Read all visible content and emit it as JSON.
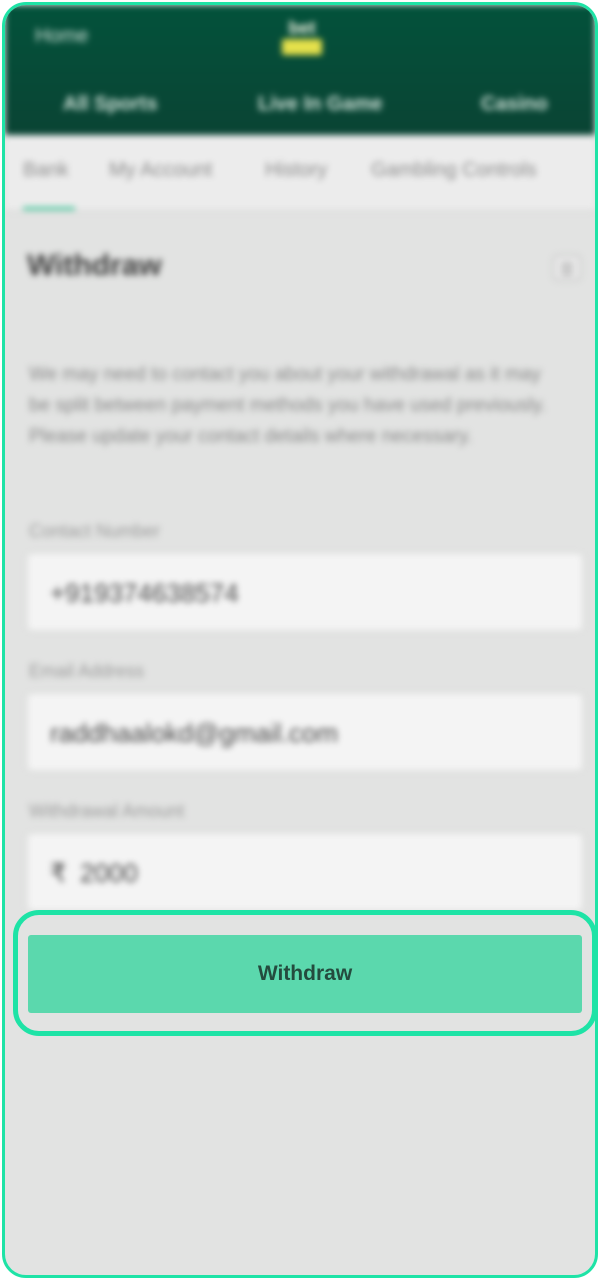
{
  "header": {
    "home_label": "Home",
    "logo_text": "bet",
    "tabs": [
      "All Sports",
      "Live In Game",
      "Casino"
    ]
  },
  "subnav": {
    "items": [
      "Bank",
      "My Account",
      "History",
      "Gambling Controls"
    ]
  },
  "page": {
    "title": "Withdraw",
    "info_text": "We may need to contact you about your withdrawal as it may be split between payment methods you have used previously. Please update your contact details where necessary."
  },
  "form": {
    "contact_label": "Contact Number",
    "contact_value": "+919374638574",
    "email_label": "Email Address",
    "email_value": "raddhaalokd@gmail.com",
    "amount_label": "Withdrawal Amount",
    "currency_symbol": "₹",
    "amount_value": "2000"
  },
  "actions": {
    "withdraw_button": "Withdraw"
  },
  "colors": {
    "header_green": "#03523b",
    "accent_mint": "#1ee3a6",
    "button_green": "#5bd8ad"
  }
}
